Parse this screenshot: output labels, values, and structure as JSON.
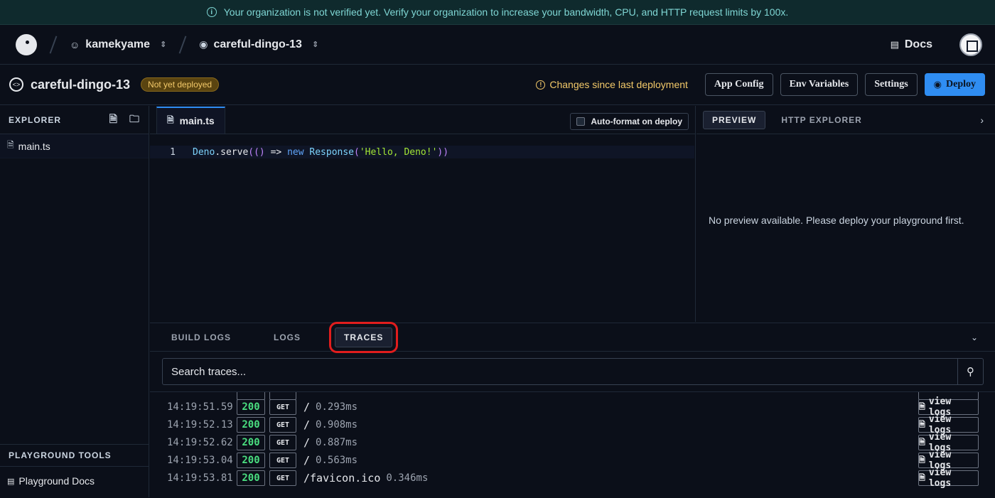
{
  "banner": {
    "text": "Your organization is not verified yet. Verify your organization to increase your bandwidth, CPU, and HTTP request limits by 100x."
  },
  "topnav": {
    "org": "kamekyame",
    "project": "careful-dingo-13",
    "docs": "Docs"
  },
  "projbar": {
    "name": "careful-dingo-13",
    "status_badge": "Not yet deployed",
    "changes": "Changes since last deployment",
    "buttons": {
      "app_config": "App Config",
      "env_variables": "Env Variables",
      "settings": "Settings",
      "deploy": "Deploy"
    }
  },
  "explorer": {
    "title": "EXPLORER",
    "files": [
      "main.ts"
    ],
    "tools_title": "PLAYGROUND TOOLS",
    "tools_item": "Playground Docs"
  },
  "editor": {
    "tab": "main.ts",
    "autoformat": "Auto-format on deploy",
    "line_number": "1",
    "code": {
      "t1": "Deno",
      "t2": ".",
      "t3": "serve",
      "t4": "(",
      "t5": "()",
      "t6": " => ",
      "t7": "new",
      "t8": " Response",
      "t9": "(",
      "t10": "'Hello, Deno!'",
      "t11": "))"
    }
  },
  "preview": {
    "tabs": [
      "PREVIEW",
      "HTTP EXPLORER"
    ],
    "message": "No preview available. Please deploy your playground first."
  },
  "bottom": {
    "tabs": [
      "BUILD LOGS",
      "LOGS",
      "TRACES"
    ],
    "search_placeholder": "Search traces...",
    "view_logs": "view logs",
    "traces": [
      {
        "time": "14:19:51.59",
        "status": "200",
        "method": "GET",
        "path": "/",
        "duration": "0.293ms"
      },
      {
        "time": "14:19:52.13",
        "status": "200",
        "method": "GET",
        "path": "/",
        "duration": "0.908ms"
      },
      {
        "time": "14:19:52.62",
        "status": "200",
        "method": "GET",
        "path": "/",
        "duration": "0.887ms"
      },
      {
        "time": "14:19:53.04",
        "status": "200",
        "method": "GET",
        "path": "/",
        "duration": "0.563ms"
      },
      {
        "time": "14:19:53.81",
        "status": "200",
        "method": "GET",
        "path": "/favicon.ico",
        "duration": "0.346ms"
      }
    ]
  }
}
